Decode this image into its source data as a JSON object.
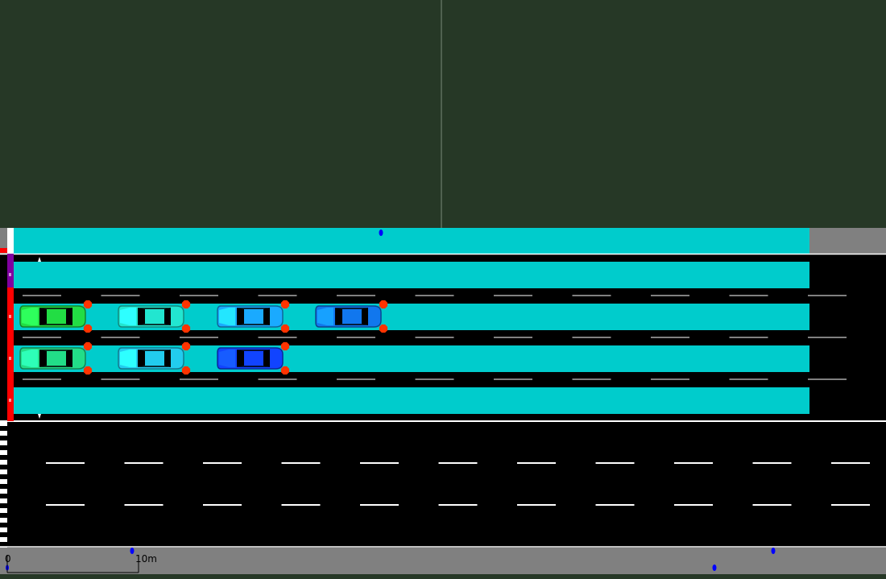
{
  "view": {
    "title": "",
    "colors": {
      "grass": "#263826",
      "road": "#000000",
      "sidewalk": "#808080",
      "lane_highlight": "#00CCCC",
      "lane_marking": "#FFFFFF",
      "signal_red": "#FF0000",
      "signal_purple": "#8000A0",
      "light_orange": "#FF3300",
      "poi_blue": "#0000FF"
    }
  },
  "scale_bar": {
    "start_label": "0",
    "end_label": "10m"
  },
  "vehicles": [
    {
      "id": "v1",
      "lane": 1,
      "color": "#22DD44"
    },
    {
      "id": "v2",
      "lane": 1,
      "color": "#22E6D0"
    },
    {
      "id": "v3",
      "lane": 1,
      "color": "#1AAAFF"
    },
    {
      "id": "v4",
      "lane": 1,
      "color": "#1177EE"
    },
    {
      "id": "v5",
      "lane": 2,
      "color": "#22DD88"
    },
    {
      "id": "v6",
      "lane": 2,
      "color": "#22CCEE"
    },
    {
      "id": "v7",
      "lane": 2,
      "color": "#1144FF"
    }
  ]
}
